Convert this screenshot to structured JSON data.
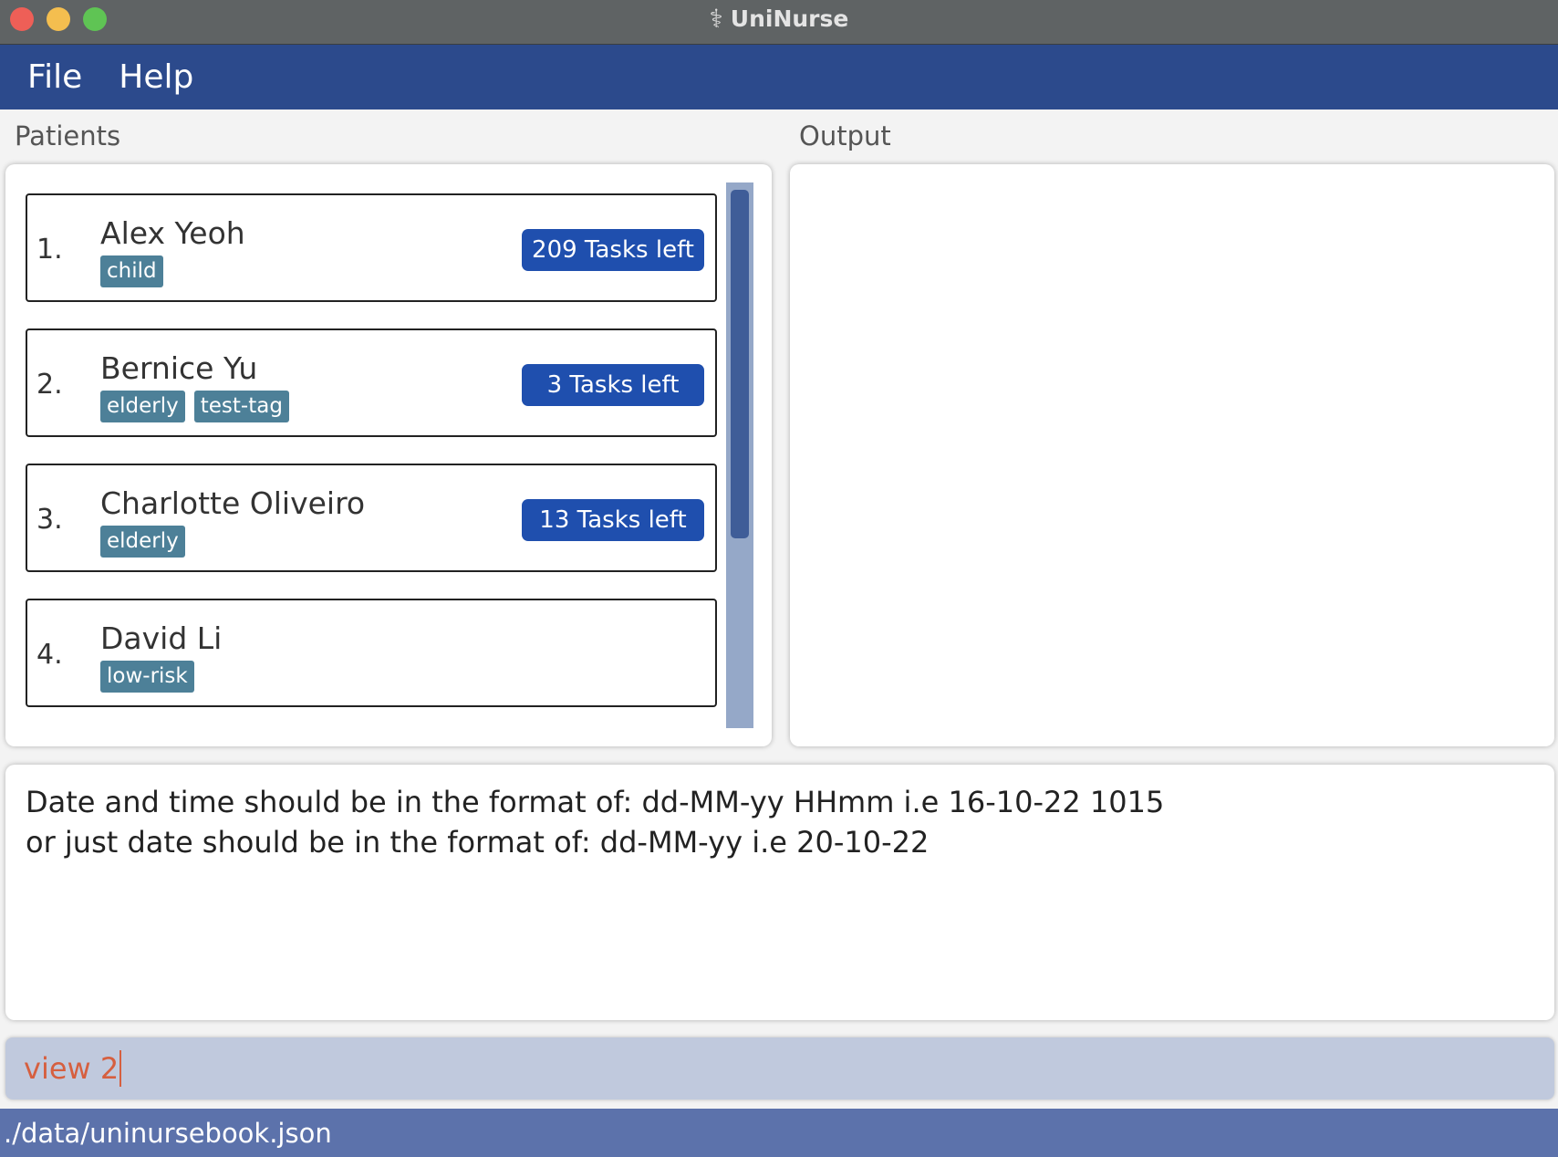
{
  "window": {
    "title": "UniNurse",
    "icon": "caduceus-icon"
  },
  "menu": {
    "items": [
      "File",
      "Help"
    ]
  },
  "sections": {
    "patients_label": "Patients",
    "output_label": "Output"
  },
  "patients": [
    {
      "index": "1.",
      "name": "Alex Yeoh",
      "tags": [
        "child"
      ],
      "tasks": "209 Tasks left"
    },
    {
      "index": "2.",
      "name": "Bernice Yu",
      "tags": [
        "elderly",
        "test-tag"
      ],
      "tasks": "3 Tasks left"
    },
    {
      "index": "3.",
      "name": "Charlotte Oliveiro",
      "tags": [
        "elderly"
      ],
      "tasks": "13 Tasks left"
    },
    {
      "index": "4.",
      "name": "David Li",
      "tags": [
        "low-risk"
      ],
      "tasks": ""
    }
  ],
  "result": {
    "lines": [
      "Date and time should be in the format of: dd-MM-yy HHmm i.e 16-10-22 1015",
      "or just date should be in the format of: dd-MM-yy i.e 20-10-22"
    ]
  },
  "command": {
    "value": "view 2"
  },
  "status": {
    "path": "./data/uninursebook.json"
  },
  "colors": {
    "menubar": "#2c4a8c",
    "tag": "#4d8098",
    "tasks_badge": "#1f4fae",
    "command_text": "#d65f3f",
    "statusbar": "#5c72ab"
  }
}
